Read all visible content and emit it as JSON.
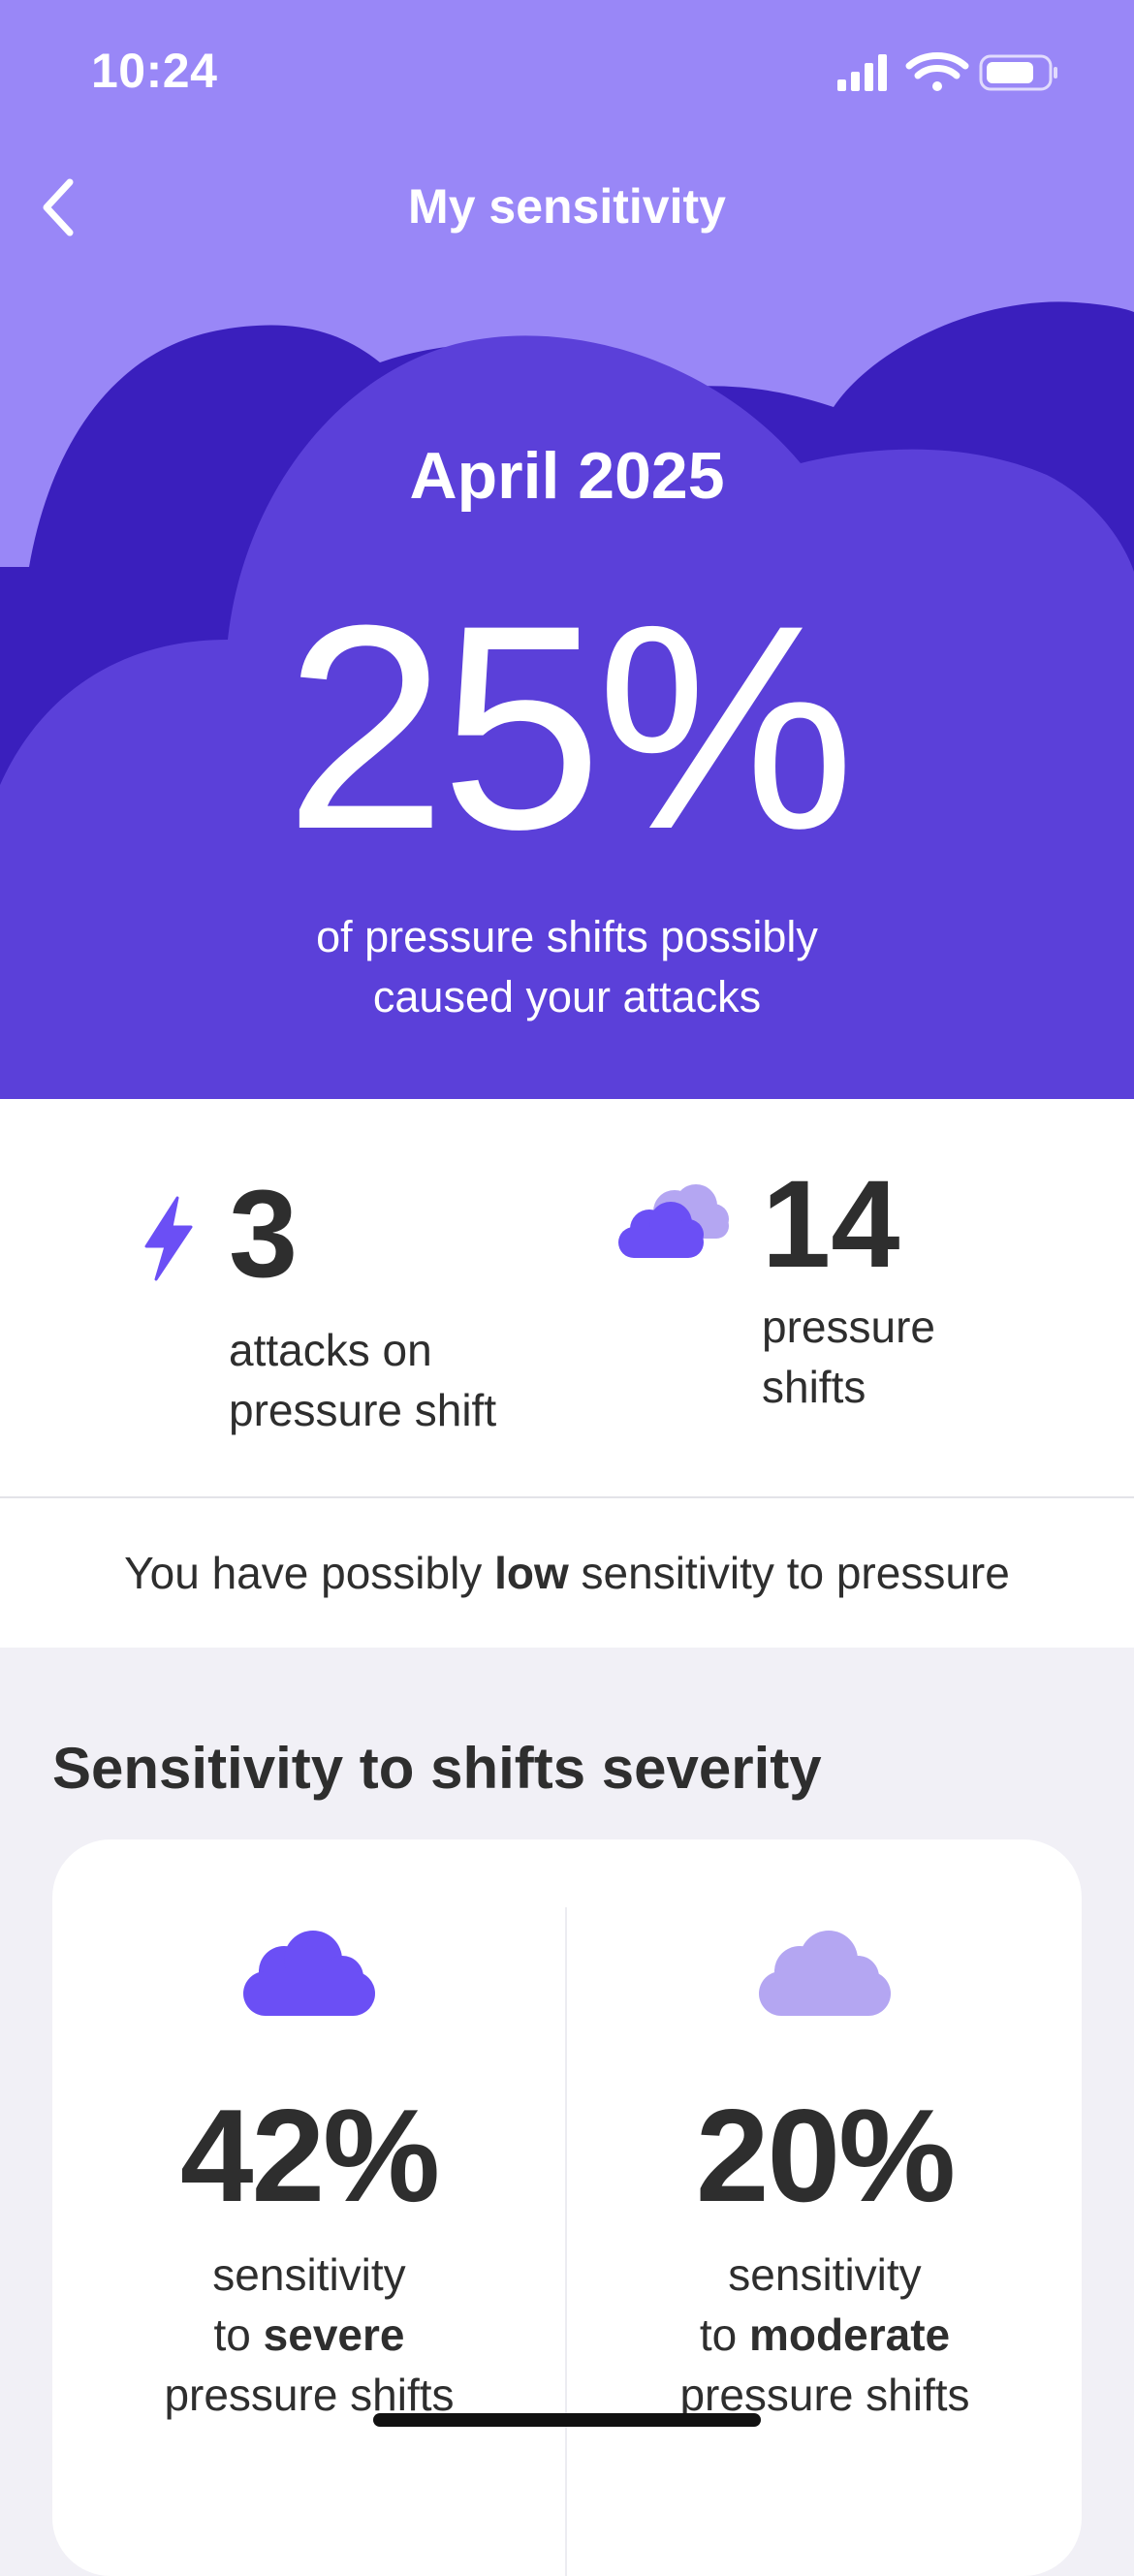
{
  "status_bar": {
    "time": "10:24",
    "icons": [
      "signal-icon",
      "wifi-icon",
      "battery-icon"
    ]
  },
  "nav": {
    "title": "My sensitivity",
    "back_icon": "chevron-left-icon"
  },
  "hero": {
    "month": "April 2025",
    "percent": "25%",
    "caption_line1": "of pressure shifts possibly",
    "caption_line2": "caused your attacks"
  },
  "stats": {
    "attacks": {
      "icon": "lightning-icon",
      "value": "3",
      "label_line1": "attacks on",
      "label_line2": "pressure shift"
    },
    "shifts": {
      "icon": "cloud-icon",
      "value": "14",
      "label_line1": "pressure",
      "label_line2": "shifts"
    }
  },
  "summary": {
    "prefix": "You have possibly",
    "level": "low",
    "suffix": "sensitivity to pressure"
  },
  "severity": {
    "title": "Sensitivity to shifts severity",
    "items": [
      {
        "icon": "severe-cloud-icon",
        "percent": "42%",
        "line1": "sensitivity",
        "line2_prefix": "to",
        "line2_bold": "severe",
        "line3": "pressure shifts"
      },
      {
        "icon": "moderate-cloud-icon",
        "percent": "20%",
        "line1": "sensitivity",
        "line2_prefix": "to",
        "line2_bold": "moderate",
        "line3": "pressure shifts"
      }
    ]
  },
  "colors": {
    "hero_light": "#9987f7",
    "cloud_dark": "#3a1fbd",
    "cloud_main": "#5b40d9",
    "accent": "#6b4ff5",
    "accent_light": "#b4a6f2",
    "background": "#f1f0f6",
    "text": "#2e2e2e"
  }
}
